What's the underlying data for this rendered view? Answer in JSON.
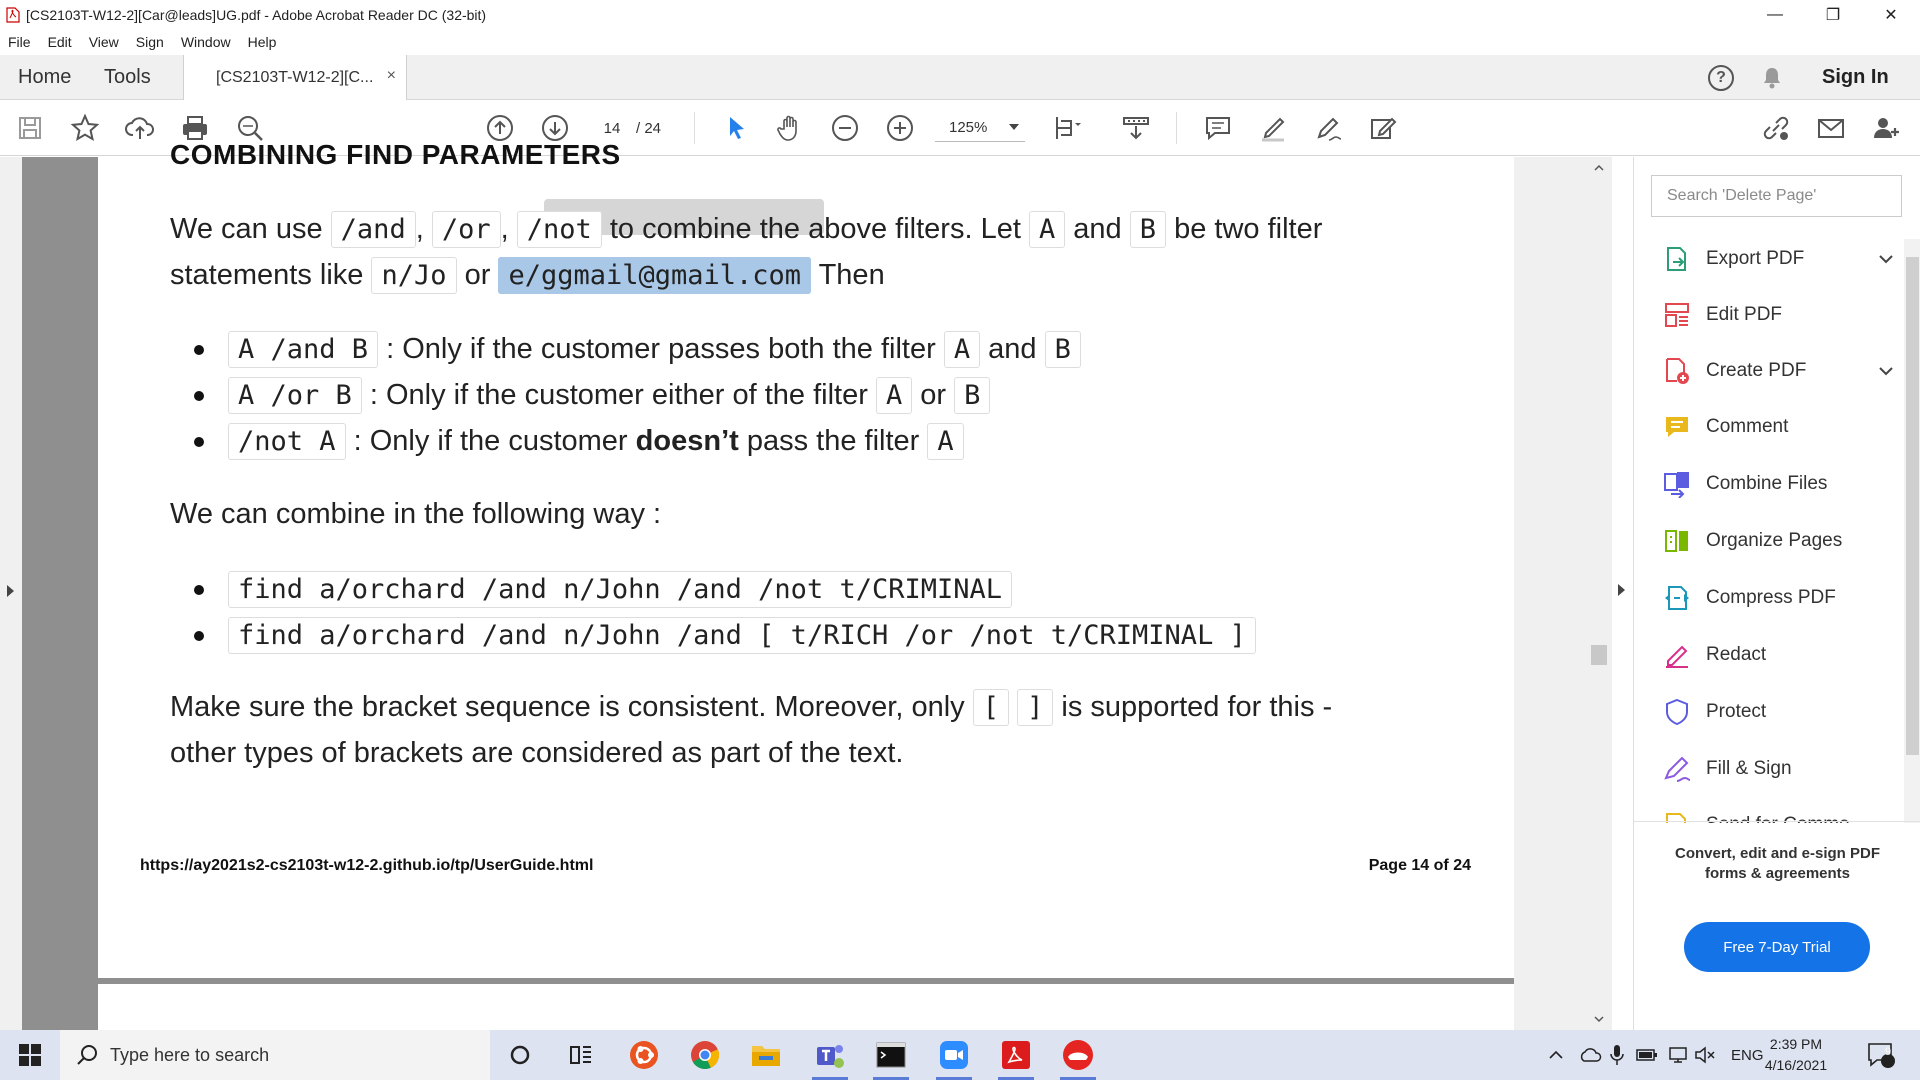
{
  "window": {
    "title": "[CS2103T-W12-2][Car@leads]UG.pdf - Adobe Acrobat Reader DC (32-bit)",
    "minimize": "—",
    "maximize": "❐",
    "close": "✕"
  },
  "menu": [
    "File",
    "Edit",
    "View",
    "Sign",
    "Window",
    "Help"
  ],
  "tabs": {
    "home": "Home",
    "tools": "Tools",
    "document": "[CS2103T-W12-2][C...",
    "close": "×",
    "sign_in": "Sign In"
  },
  "toolbar": {
    "page_current": "14",
    "page_total": "/ 24",
    "zoom": "125%"
  },
  "document": {
    "cut_heading": "COMBINING FIND PARAMETERS",
    "para1_we_can_use": "We can use",
    "and_code": "/and",
    "comma1": ",",
    "or_code": "/or",
    "comma2": ",",
    "not_code": "/not",
    "para1_rest": "to combine the above filters. Let",
    "a_code": "A",
    "and_word": "and",
    "b_code": "B",
    "para1_end": "be two filter",
    "para2_start": "statements like",
    "njo_code": "n/Jo",
    "or_word": "or",
    "email_code": "e/ggmail@gmail.com",
    "then_word": "Then",
    "b1_code": "A /and B",
    "b1_text": ": Only if the customer passes both the filter",
    "b1_a": "A",
    "b1_and": "and",
    "b1_b": "B",
    "b2_code": "A /or B",
    "b2_text": ": Only if the customer either of the filter",
    "b2_a": "A",
    "b2_or": "or",
    "b2_b": "B",
    "b3_code": "/not A",
    "b3_text_before": ": Only if the customer",
    "b3_bold": "doesn’t",
    "b3_text_after": "pass the filter",
    "b3_a": "A",
    "combine_line": "We can combine in the following way :",
    "ex1": "find a/orchard /and n/John /and /not t/CRIMINAL",
    "ex2": "find a/orchard /and n/John /and [ t/RICH /or /not t/CRIMINAL ]",
    "para3_start": "Make sure the bracket sequence is consistent. Moreover, only",
    "bracket_open": "[",
    "bracket_close": "]",
    "para3_end": "is supported for this -",
    "para4": "other types of brackets are considered as part of the text.",
    "footer_url": "https://ay2021s2-cs2103t-w12-2.github.io/tp/UserGuide.html",
    "footer_page": "Page 14 of 24"
  },
  "right_panel": {
    "search_placeholder": "Search 'Delete Page'",
    "tools": [
      {
        "label": "Export PDF",
        "icon": "export-pdf-icon",
        "color": "#2d9d78"
      },
      {
        "label": "Edit PDF",
        "icon": "edit-pdf-icon",
        "color": "#e34850"
      },
      {
        "label": "Create PDF",
        "icon": "create-pdf-icon",
        "color": "#e34850"
      },
      {
        "label": "Comment",
        "icon": "comment-icon",
        "color": "#e8b81c"
      },
      {
        "label": "Combine Files",
        "icon": "combine-files-icon",
        "color": "#5c5ce0"
      },
      {
        "label": "Organize Pages",
        "icon": "organize-pages-icon",
        "color": "#7ab800"
      },
      {
        "label": "Compress PDF",
        "icon": "compress-pdf-icon",
        "color": "#1d97b8"
      },
      {
        "label": "Redact",
        "icon": "redact-icon",
        "color": "#d8308a"
      },
      {
        "label": "Protect",
        "icon": "protect-icon",
        "color": "#5c5ce0"
      },
      {
        "label": "Fill & Sign",
        "icon": "fill-sign-icon",
        "color": "#8c5ae0"
      },
      {
        "label": "Send for Comme",
        "icon": "send-for-comment-icon",
        "color": "#e8b81c"
      }
    ],
    "promo_text": "Convert, edit and e-sign PDF forms & agreements",
    "trial_button": "Free 7-Day Trial"
  },
  "taskbar": {
    "search_placeholder": "Type here to search",
    "language": "ENG",
    "time": "2:39 PM",
    "date": "4/16/2021",
    "notification_count": "9"
  }
}
